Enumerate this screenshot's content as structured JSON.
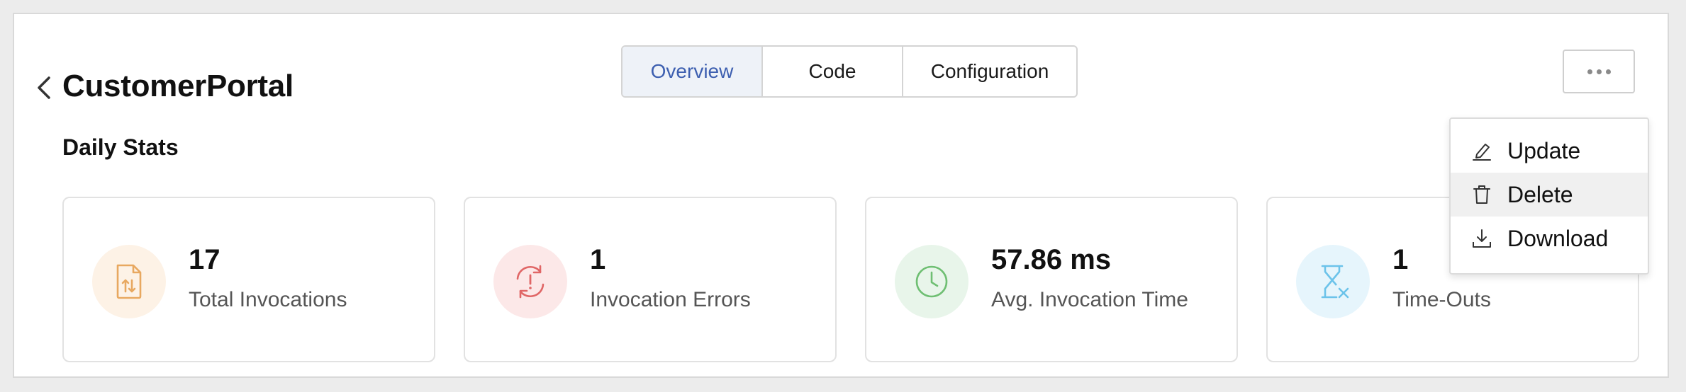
{
  "header": {
    "title": "CustomerPortal",
    "back_icon": "chevron-left-icon",
    "more_icon": "ellipsis-icon"
  },
  "tabs": [
    {
      "label": "Overview",
      "active": true
    },
    {
      "label": "Code",
      "active": false
    },
    {
      "label": "Configuration",
      "active": false
    }
  ],
  "section": {
    "title": "Daily Stats"
  },
  "stats": [
    {
      "value": "17",
      "label": "Total Invocations",
      "icon": "file-transfer-icon",
      "color": "#e8a860",
      "bg": "#fdf2e6"
    },
    {
      "value": "1",
      "label": "Invocation Errors",
      "icon": "refresh-alert-icon",
      "color": "#e06666",
      "bg": "#fce8e8"
    },
    {
      "value": "57.86 ms",
      "label": "Avg. Invocation Time",
      "icon": "clock-icon",
      "color": "#6fbf73",
      "bg": "#e8f5ea"
    },
    {
      "value": "1",
      "label": "Time-Outs",
      "icon": "hourglass-x-icon",
      "color": "#6cc3ea",
      "bg": "#e6f5fc"
    }
  ],
  "menu": {
    "items": [
      {
        "label": "Update",
        "icon": "edit-icon"
      },
      {
        "label": "Delete",
        "icon": "trash-icon"
      },
      {
        "label": "Download",
        "icon": "download-icon"
      }
    ]
  },
  "colors": {
    "accent": "#3d5fb0",
    "active_tab_bg": "#eef2f8"
  }
}
